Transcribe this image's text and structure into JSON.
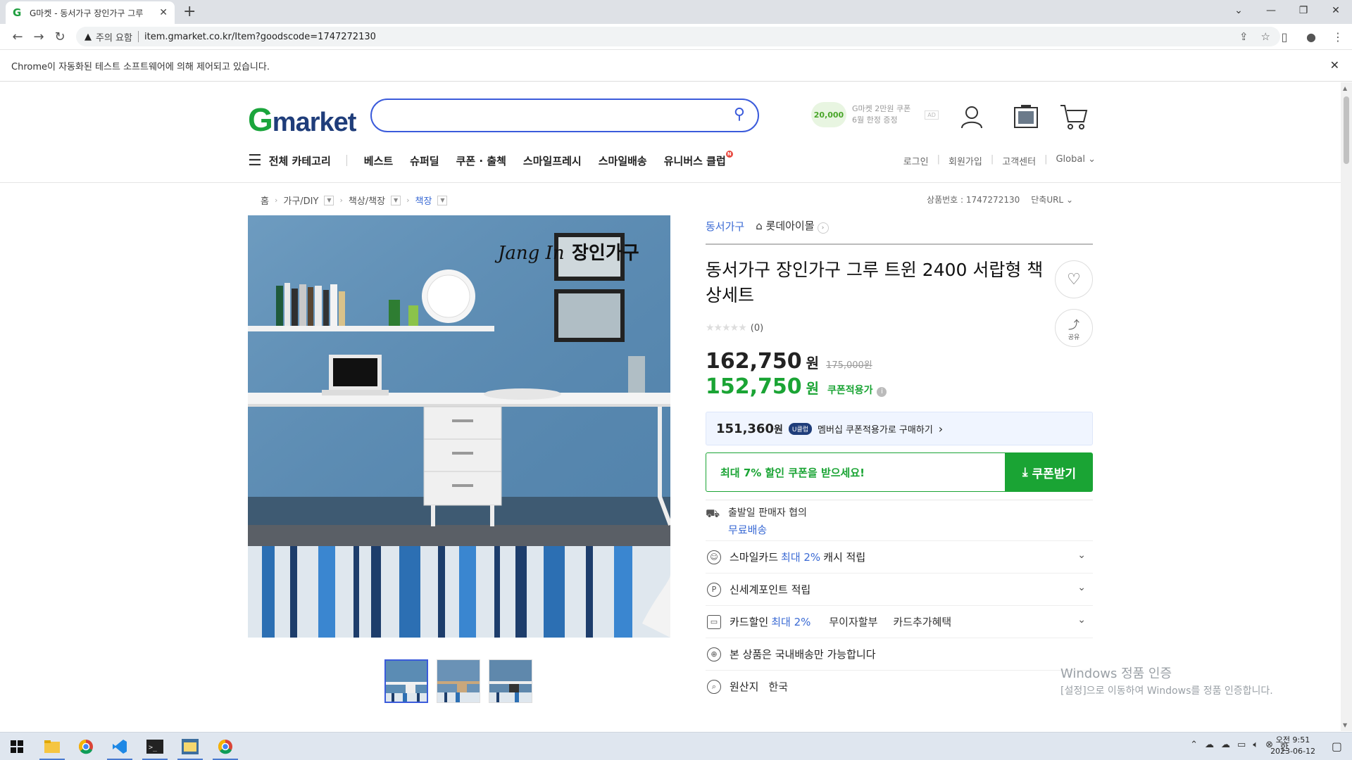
{
  "browser": {
    "tab_title": "G마켓 - 동서가구 장인가구 그루",
    "url": "item.gmarket.co.kr/Item?goodscode=1747272130",
    "security_label": "주의 요함",
    "infobar_text": "Chrome이 자동화된 테스트 소프트웨어에 의해 제어되고 있습니다."
  },
  "header": {
    "logo_g": "G",
    "logo_rest": "market",
    "search_placeholder": "",
    "promo_badge": "20,000",
    "promo_line1": "G마켓 2만원 쿠폰",
    "promo_line2": "6월 한정 증정",
    "promo_ad": "AD"
  },
  "gnb": {
    "all_categories": "전체 카테고리",
    "items": [
      "베스트",
      "슈퍼딜",
      "쿠폰 · 출첵",
      "스마일프레시",
      "스마일배송",
      "유니버스 클럽"
    ],
    "badge": "N",
    "util": [
      "로그인",
      "회원가입",
      "고객센터",
      "Global"
    ]
  },
  "breadcrumb": {
    "home": "홈",
    "level1": "가구/DIY",
    "level2": "책상/책장",
    "level3": "책장"
  },
  "goods": {
    "code_label": "상품번호 : 1747272130",
    "short_url": "단축URL"
  },
  "product": {
    "seller": "동서가구",
    "shop": "롯데아이몰",
    "title": "동서가구 장인가구 그루 트윈 2400 서랍형 책상세트",
    "review_count": "(0)",
    "rating": 0,
    "price": "162,750",
    "won": "원",
    "original_price": "175,000원",
    "coupon_price": "152,750",
    "coupon_label": "쿠폰적용가",
    "member_price": "151,360",
    "member_won": "원",
    "member_badge": "U클럽",
    "member_text": "멤버십 쿠폰적용가로 구매하기",
    "coupon_banner": "최대 7% 할인 쿠폰을 받으세요!",
    "coupon_button": "쿠폰받기",
    "share_label": "공유",
    "image_watermark": "장인가구",
    "image_signature": "Jang In"
  },
  "shipping": {
    "line1": "출발일 판매자 협의",
    "free": "무료배송"
  },
  "benefits": [
    {
      "label": "스마일카드",
      "highlight": "최대 2%",
      "suffix": "캐시 적립"
    },
    {
      "label": "신세계포인트 적립",
      "highlight": "",
      "suffix": ""
    },
    {
      "label": "카드할인",
      "highlight": "최대 2%",
      "suffix": "",
      "sub1": "무이자할부",
      "sub2": "카드추가혜택"
    },
    {
      "label": "본 상품은 국내배송만 가능합니다",
      "highlight": "",
      "suffix": ""
    },
    {
      "label": "원산지",
      "highlight": "",
      "suffix": "",
      "value": "한국"
    }
  ],
  "watermark": {
    "line1": "Windows 정품 인증",
    "line2": "[설정]으로 이동하여 Windows를 정품 인증합니다."
  },
  "taskbar": {
    "ime": "한",
    "time": "오전 9:51",
    "date": "2023-06-12"
  },
  "colors": {
    "brand_green": "#1aa434",
    "brand_blue": "#1f3d7a",
    "link_blue": "#3a6ad4",
    "search_border": "#3b5bdb"
  }
}
